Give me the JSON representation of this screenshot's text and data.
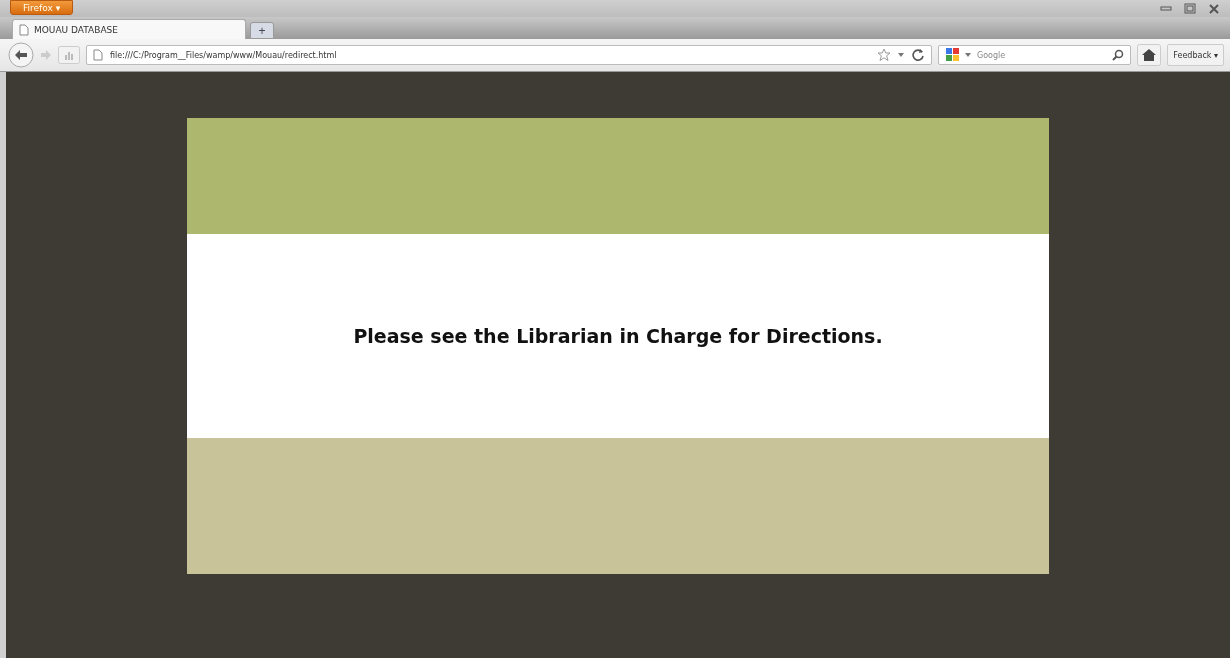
{
  "app_button": {
    "label": "Firefox ▾"
  },
  "tabs": [
    {
      "title": "MOUAU DATABASE",
      "selected": true
    }
  ],
  "new_tab": {
    "label": "+"
  },
  "address_bar": {
    "value": "file:///C:/Program__Files/wamp/www/Mouau/redirect.html"
  },
  "search": {
    "placeholder": "Google"
  },
  "feedback": {
    "label": "Feedback ▾"
  },
  "page": {
    "message": "Please see the Librarian in Charge for Directions."
  }
}
